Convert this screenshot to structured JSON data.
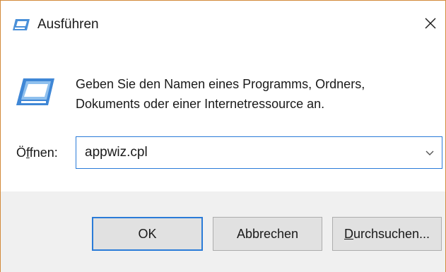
{
  "window": {
    "title": "Ausführen",
    "close_glyph": "✕"
  },
  "content": {
    "description": "Geben Sie den Namen eines Programms, Ordners,\nDokuments oder einer Internetressource an.",
    "open_label_prefix": "Ö",
    "open_label_mnemonic": "f",
    "open_label_suffix": "fnen:",
    "input_value": "appwiz.cpl"
  },
  "buttons": {
    "ok_label": "OK",
    "cancel_label": "Abbrechen",
    "browse_mnemonic": "D",
    "browse_rest": "urchsuchen..."
  },
  "icons": {
    "title_icon": "run-icon",
    "big_icon": "run-icon",
    "close": "close-icon",
    "dropdown": "chevron-down-icon"
  },
  "colors": {
    "window_border": "#d38a3a",
    "focus_blue": "#2a7bd8",
    "footer_bg": "#f0f0f0",
    "button_bg": "#e1e1e1"
  }
}
